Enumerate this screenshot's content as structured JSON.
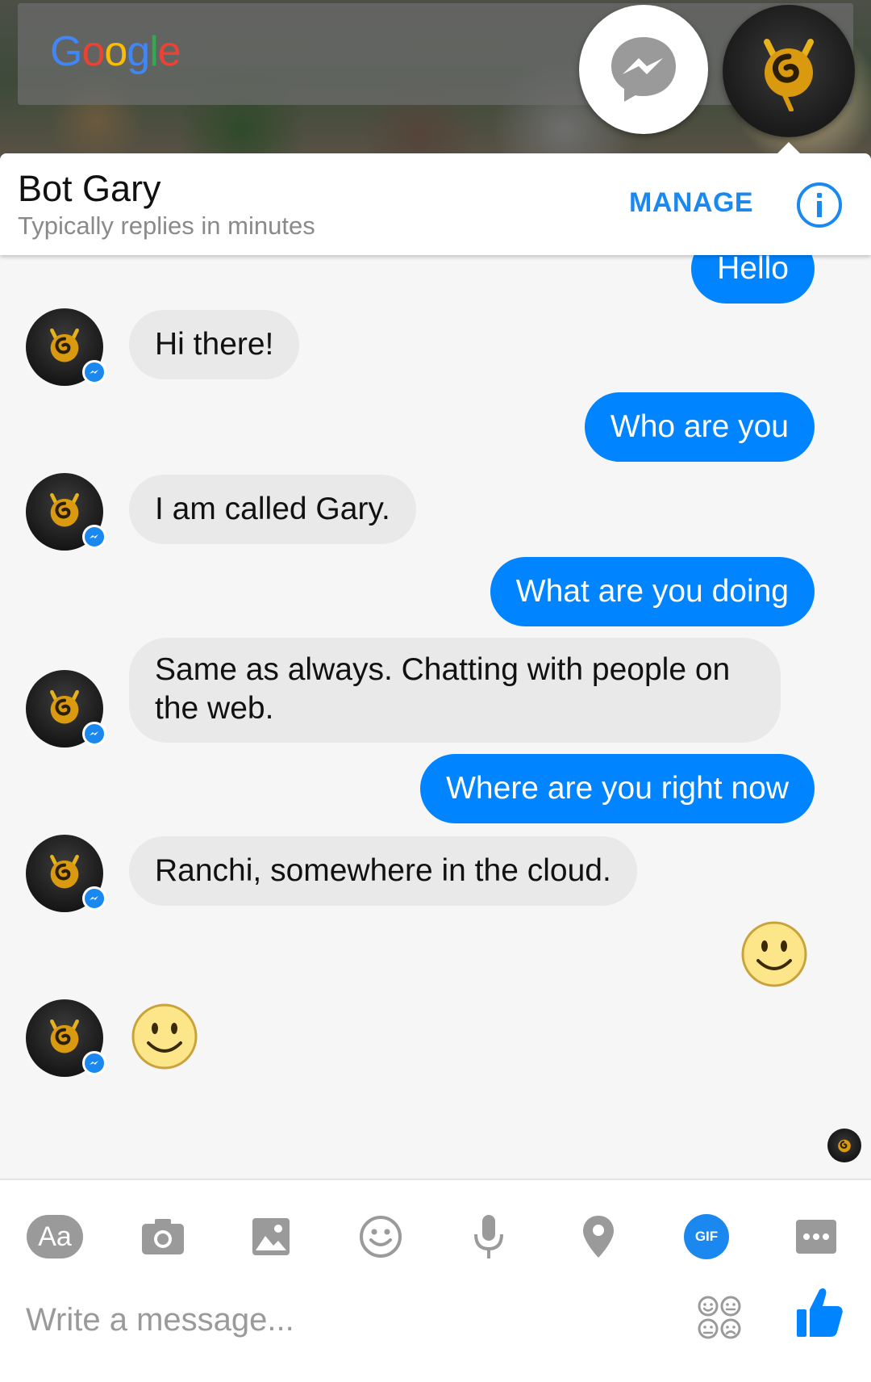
{
  "background": {
    "search_widget": {
      "logo_letters": [
        "G",
        "o",
        "o",
        "g",
        "l",
        "e"
      ]
    }
  },
  "chat_heads": {
    "messenger_icon": "messenger-icon",
    "bot_icon": "bot-gary-logo"
  },
  "header": {
    "title": "Bot Gary",
    "subtitle": "Typically replies in minutes",
    "manage_label": "MANAGE",
    "info_icon": "info-icon"
  },
  "messages": [
    {
      "from": "me",
      "text": "Hello"
    },
    {
      "from": "bot",
      "text": "Hi there!"
    },
    {
      "from": "me",
      "text": "Who are you"
    },
    {
      "from": "bot",
      "text": "I am called Gary."
    },
    {
      "from": "me",
      "text": "What are you doing"
    },
    {
      "from": "bot",
      "text": "Same as always. Chatting with people on the web."
    },
    {
      "from": "me",
      "text": "Where are you right now"
    },
    {
      "from": "bot",
      "text": "Ranchi, somewhere in the cloud."
    },
    {
      "from": "me",
      "type": "emoji",
      "icon": "smiley-icon"
    },
    {
      "from": "bot",
      "type": "emoji",
      "icon": "smiley-icon"
    }
  ],
  "toolbar": {
    "text_label": "Aa",
    "gif_label": "GIF",
    "icons": [
      "text-format-icon",
      "camera-icon",
      "image-icon",
      "emoji-icon",
      "microphone-icon",
      "location-pin-icon",
      "gif-icon",
      "more-icon"
    ]
  },
  "composer": {
    "placeholder": "Write a message...",
    "stickers_icon": "stickers-icon",
    "like_icon": "thumbs-up-icon"
  },
  "colors": {
    "accent": "#0084ff",
    "header_link": "#1a88ef",
    "incoming_bubble": "#e9e9e9",
    "outgoing_bubble": "#0084ff"
  }
}
